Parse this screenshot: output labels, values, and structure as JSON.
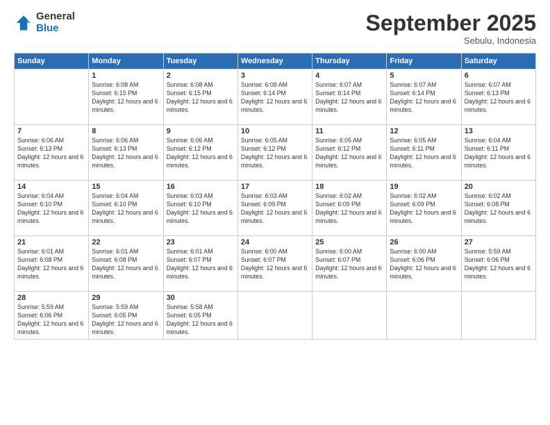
{
  "header": {
    "logo_general": "General",
    "logo_blue": "Blue",
    "month": "September 2025",
    "location": "Sebulu, Indonesia"
  },
  "days_of_week": [
    "Sunday",
    "Monday",
    "Tuesday",
    "Wednesday",
    "Thursday",
    "Friday",
    "Saturday"
  ],
  "weeks": [
    [
      {
        "day": "",
        "info": ""
      },
      {
        "day": "1",
        "info": "Sunrise: 6:08 AM\nSunset: 6:15 PM\nDaylight: 12 hours\nand 6 minutes."
      },
      {
        "day": "2",
        "info": "Sunrise: 6:08 AM\nSunset: 6:15 PM\nDaylight: 12 hours\nand 6 minutes."
      },
      {
        "day": "3",
        "info": "Sunrise: 6:08 AM\nSunset: 6:14 PM\nDaylight: 12 hours\nand 6 minutes."
      },
      {
        "day": "4",
        "info": "Sunrise: 6:07 AM\nSunset: 6:14 PM\nDaylight: 12 hours\nand 6 minutes."
      },
      {
        "day": "5",
        "info": "Sunrise: 6:07 AM\nSunset: 6:14 PM\nDaylight: 12 hours\nand 6 minutes."
      },
      {
        "day": "6",
        "info": "Sunrise: 6:07 AM\nSunset: 6:13 PM\nDaylight: 12 hours\nand 6 minutes."
      }
    ],
    [
      {
        "day": "7",
        "info": "Sunrise: 6:06 AM\nSunset: 6:13 PM\nDaylight: 12 hours\nand 6 minutes."
      },
      {
        "day": "8",
        "info": "Sunrise: 6:06 AM\nSunset: 6:13 PM\nDaylight: 12 hours\nand 6 minutes."
      },
      {
        "day": "9",
        "info": "Sunrise: 6:06 AM\nSunset: 6:12 PM\nDaylight: 12 hours\nand 6 minutes."
      },
      {
        "day": "10",
        "info": "Sunrise: 6:05 AM\nSunset: 6:12 PM\nDaylight: 12 hours\nand 6 minutes."
      },
      {
        "day": "11",
        "info": "Sunrise: 6:05 AM\nSunset: 6:12 PM\nDaylight: 12 hours\nand 6 minutes."
      },
      {
        "day": "12",
        "info": "Sunrise: 6:05 AM\nSunset: 6:11 PM\nDaylight: 12 hours\nand 6 minutes."
      },
      {
        "day": "13",
        "info": "Sunrise: 6:04 AM\nSunset: 6:11 PM\nDaylight: 12 hours\nand 6 minutes."
      }
    ],
    [
      {
        "day": "14",
        "info": "Sunrise: 6:04 AM\nSunset: 6:10 PM\nDaylight: 12 hours\nand 6 minutes."
      },
      {
        "day": "15",
        "info": "Sunrise: 6:04 AM\nSunset: 6:10 PM\nDaylight: 12 hours\nand 6 minutes."
      },
      {
        "day": "16",
        "info": "Sunrise: 6:03 AM\nSunset: 6:10 PM\nDaylight: 12 hours\nand 6 minutes."
      },
      {
        "day": "17",
        "info": "Sunrise: 6:03 AM\nSunset: 6:09 PM\nDaylight: 12 hours\nand 6 minutes."
      },
      {
        "day": "18",
        "info": "Sunrise: 6:02 AM\nSunset: 6:09 PM\nDaylight: 12 hours\nand 6 minutes."
      },
      {
        "day": "19",
        "info": "Sunrise: 6:02 AM\nSunset: 6:09 PM\nDaylight: 12 hours\nand 6 minutes."
      },
      {
        "day": "20",
        "info": "Sunrise: 6:02 AM\nSunset: 6:08 PM\nDaylight: 12 hours\nand 6 minutes."
      }
    ],
    [
      {
        "day": "21",
        "info": "Sunrise: 6:01 AM\nSunset: 6:08 PM\nDaylight: 12 hours\nand 6 minutes."
      },
      {
        "day": "22",
        "info": "Sunrise: 6:01 AM\nSunset: 6:08 PM\nDaylight: 12 hours\nand 6 minutes."
      },
      {
        "day": "23",
        "info": "Sunrise: 6:01 AM\nSunset: 6:07 PM\nDaylight: 12 hours\nand 6 minutes."
      },
      {
        "day": "24",
        "info": "Sunrise: 6:00 AM\nSunset: 6:07 PM\nDaylight: 12 hours\nand 6 minutes."
      },
      {
        "day": "25",
        "info": "Sunrise: 6:00 AM\nSunset: 6:07 PM\nDaylight: 12 hours\nand 6 minutes."
      },
      {
        "day": "26",
        "info": "Sunrise: 6:00 AM\nSunset: 6:06 PM\nDaylight: 12 hours\nand 6 minutes."
      },
      {
        "day": "27",
        "info": "Sunrise: 5:59 AM\nSunset: 6:06 PM\nDaylight: 12 hours\nand 6 minutes."
      }
    ],
    [
      {
        "day": "28",
        "info": "Sunrise: 5:59 AM\nSunset: 6:06 PM\nDaylight: 12 hours\nand 6 minutes."
      },
      {
        "day": "29",
        "info": "Sunrise: 5:59 AM\nSunset: 6:05 PM\nDaylight: 12 hours\nand 6 minutes."
      },
      {
        "day": "30",
        "info": "Sunrise: 5:58 AM\nSunset: 6:05 PM\nDaylight: 12 hours\nand 6 minutes."
      },
      {
        "day": "",
        "info": ""
      },
      {
        "day": "",
        "info": ""
      },
      {
        "day": "",
        "info": ""
      },
      {
        "day": "",
        "info": ""
      }
    ]
  ]
}
